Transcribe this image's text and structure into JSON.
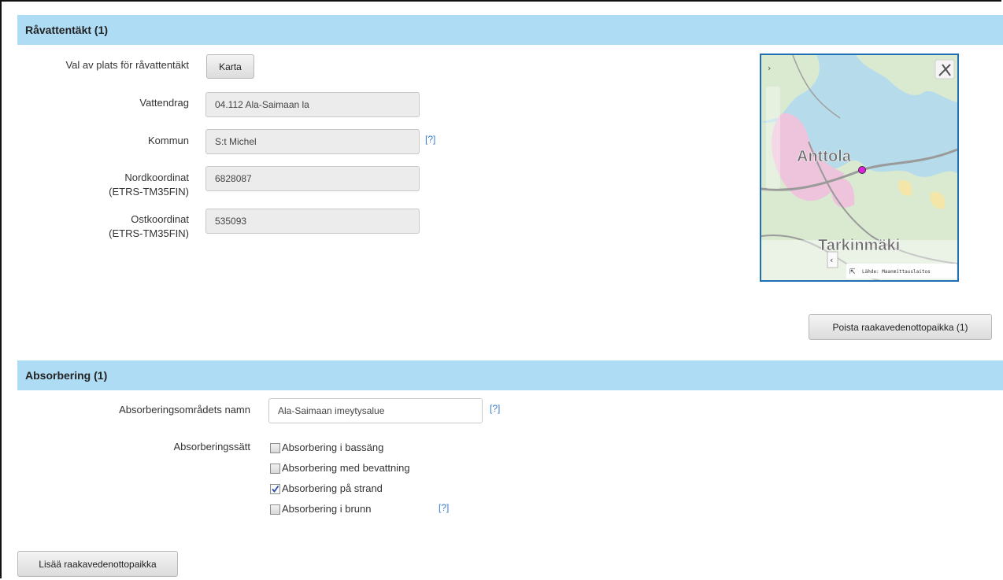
{
  "section1": {
    "title": "Råvattentäkt (1)",
    "place_label": "Val av plats för råvattentäkt",
    "map_button": "Karta",
    "vattendrag_label": "Vattendrag",
    "vattendrag_value": "04.112 Ala-Saimaan la",
    "kommun_label": "Kommun",
    "kommun_value": "S:t Michel",
    "help": "[?]",
    "nord_label_1": "Nordkoordinat",
    "nord_label_2": "(ETRS-TM35FIN)",
    "nord_value": "6828087",
    "ost_label_1": "Ostkoordinat",
    "ost_label_2": "(ETRS-TM35FIN)",
    "ost_value": "535093",
    "remove_button": "Poista raakavedenottopaikka (1)"
  },
  "map": {
    "place_1": "Anttola",
    "place_2": "Tarkinmäki",
    "attribution": "Lähde: Maanmittauslaitos",
    "expand_icon": "tools-icon"
  },
  "section2": {
    "title": "Absorbering (1)",
    "name_label": "Absorberingsområdets namn",
    "name_value": "Ala-Saimaan imeytysalue",
    "help": "[?]",
    "method_label": "Absorberingssätt",
    "methods": [
      {
        "label": "Absorbering i bassäng",
        "checked": false
      },
      {
        "label": "Absorbering med bevattning",
        "checked": false
      },
      {
        "label": "Absorbering på strand",
        "checked": true
      },
      {
        "label": "Absorbering i brunn",
        "checked": false
      }
    ]
  },
  "footer": {
    "add_button": "Lisää raakavedenottopaikka"
  }
}
